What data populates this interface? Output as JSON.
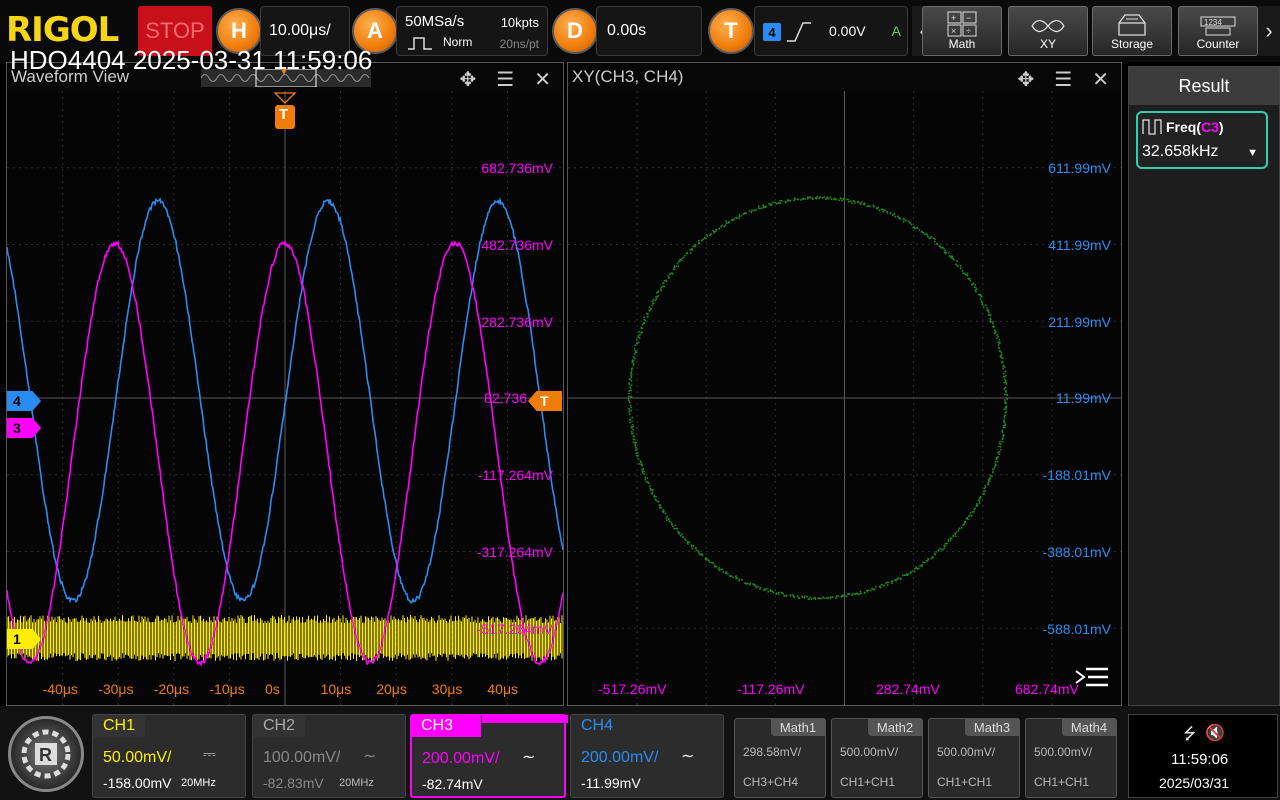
{
  "brand": "RIGOL",
  "overlay_title": "HDO4404 2025-03-31 11:59:06",
  "status": "STOP",
  "horizontal": {
    "button": "H",
    "timebase": "10.00μs/"
  },
  "acquisition": {
    "button": "A",
    "sample_rate": "50MSa/s",
    "memory_depth": "10kpts",
    "mode": "Norm",
    "sample_interval": "20ns/pt"
  },
  "delay": {
    "button": "D",
    "value": "0.00s"
  },
  "trigger": {
    "button": "T",
    "source": "4",
    "level": "0.00V",
    "mode_letter": "A"
  },
  "toolbar": [
    {
      "label": "Math",
      "icon": "math-icon"
    },
    {
      "label": "XY",
      "icon": "xy-icon"
    },
    {
      "label": "Storage",
      "icon": "storage-icon"
    },
    {
      "label": "Counter",
      "icon": "counter-icon"
    }
  ],
  "waveform_view": {
    "title": "Waveform View",
    "time_ticks": [
      "-40μs",
      "-30μs",
      "-20μs",
      "-10μs",
      "0s",
      "10μs",
      "20μs",
      "30μs",
      "40μs"
    ],
    "volt_ticks": [
      "682.736mV",
      "482.736mV",
      "282.736mV",
      "82.736",
      "-117.264mV",
      "-317.264mV",
      "-517.264mV"
    ],
    "trigger_marker": "T",
    "channel_markers": [
      "4",
      "3",
      "1"
    ]
  },
  "xy_view": {
    "title": "XY(CH3, CH4)",
    "y_ticks": [
      "611.99mV",
      "411.99mV",
      "211.99mV",
      "11.99mV",
      "-188.01mV",
      "-388.01mV",
      "-588.01mV"
    ],
    "x_ticks": [
      "-517.26mV",
      "-117.26mV",
      "282.74mV",
      "682.74mV"
    ]
  },
  "result": {
    "title": "Result",
    "measure_name": "Freq(",
    "measure_source": "C3",
    "measure_close": ")",
    "measure_value": "32.658kHz"
  },
  "channels": [
    {
      "name": "CH1",
      "scale": "50.00mV/",
      "offset": "-158.00mV",
      "bandwidth": "20MHz",
      "coupling": "DC",
      "color": "#ffee00"
    },
    {
      "name": "CH2",
      "scale": "100.00mV/",
      "offset": "-82.83mV",
      "bandwidth": "20MHz",
      "coupling": "AC",
      "color": "#888888"
    },
    {
      "name": "CH3",
      "scale": "200.00mV/",
      "offset": "-82.74mV",
      "bandwidth": "",
      "coupling": "AC",
      "color": "#ff00ff"
    },
    {
      "name": "CH4",
      "scale": "200.00mV/",
      "offset": "-11.99mV",
      "bandwidth": "",
      "coupling": "AC",
      "color": "#2a8cf0"
    }
  ],
  "math": [
    {
      "name": "Math1",
      "value": "298.58mV/",
      "source": "CH3+CH4"
    },
    {
      "name": "Math2",
      "value": "500.00mV/",
      "source": "CH1+CH1"
    },
    {
      "name": "Math3",
      "value": "500.00mV/",
      "source": "CH1+CH1"
    },
    {
      "name": "Math4",
      "value": "500.00mV/",
      "source": "CH1+CH1"
    }
  ],
  "clock": {
    "time": "11:59:06",
    "date": "2025/03/31"
  }
}
